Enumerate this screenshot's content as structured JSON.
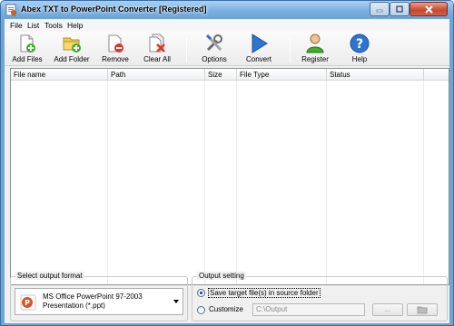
{
  "window": {
    "title": "Abex TXT to PowerPoint Converter [Registered]"
  },
  "menu": [
    "File",
    "List",
    "Tools",
    "Help"
  ],
  "toolbar": {
    "add_files": "Add Files",
    "add_folder": "Add Folder",
    "remove": "Remove",
    "clear_all": "Clear All",
    "options": "Options",
    "convert": "Convert",
    "register": "Register",
    "help": "Help"
  },
  "file_list": {
    "columns": [
      "File name",
      "Path",
      "Size",
      "File Type",
      "Status"
    ],
    "rows": []
  },
  "output_format": {
    "group_title": "Select output format",
    "selected_line1": "MS Office PowerPoint 97-2003",
    "selected_line2": "Presentation (*.ppt)"
  },
  "output_setting": {
    "group_title": "Output setting",
    "option_source": "Save target file(s) in source folder",
    "option_customize": "Customize",
    "selected": "source",
    "path_value": "C:\\Output",
    "browse_label": "..."
  },
  "colors": {
    "accent": "#3a6ea5",
    "convert_arrow": "#2f74d0"
  }
}
